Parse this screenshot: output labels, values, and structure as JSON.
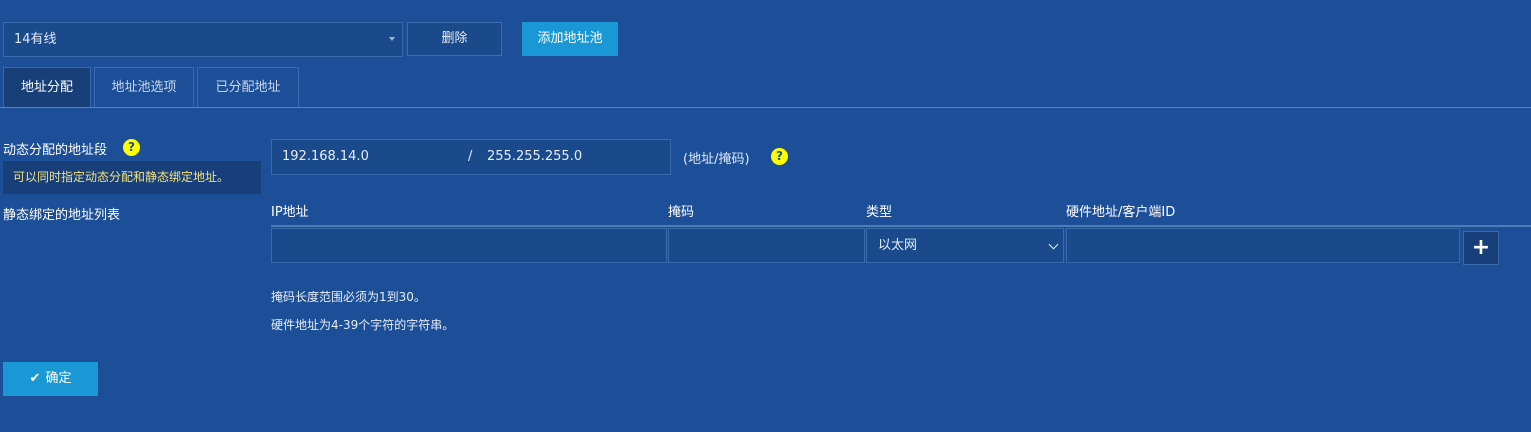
{
  "pool": {
    "selected": "14有线",
    "delete_label": "删除",
    "add_label": "添加地址池"
  },
  "tabs": [
    {
      "label": "地址分配",
      "active": true
    },
    {
      "label": "地址池选项",
      "active": false
    },
    {
      "label": "已分配地址",
      "active": false
    }
  ],
  "dynamic": {
    "label": "动态分配的地址段",
    "tip": "可以同时指定动态分配和静态绑定地址。",
    "ip": "192.168.14.0",
    "separator": "/",
    "mask": "255.255.255.0",
    "hint": "(地址/掩码)"
  },
  "static_list": {
    "label": "静态绑定的地址列表",
    "columns": [
      "IP地址",
      "掩码",
      "类型",
      "硬件地址/客户端ID"
    ],
    "row": {
      "ip": "",
      "mask": "",
      "type": "以太网",
      "hw": ""
    },
    "add_symbol": "+"
  },
  "notes": [
    "掩码长度范围必须为1到30。",
    "硬件地址为4-39个字符的字符串。"
  ],
  "confirm_label": "确定",
  "icons": {
    "help": "?",
    "check": "✔"
  },
  "colors": {
    "background": "#1d4f99",
    "accent": "#1a98d6",
    "help": "#ffff00",
    "tip_text": "#f2e27a"
  }
}
